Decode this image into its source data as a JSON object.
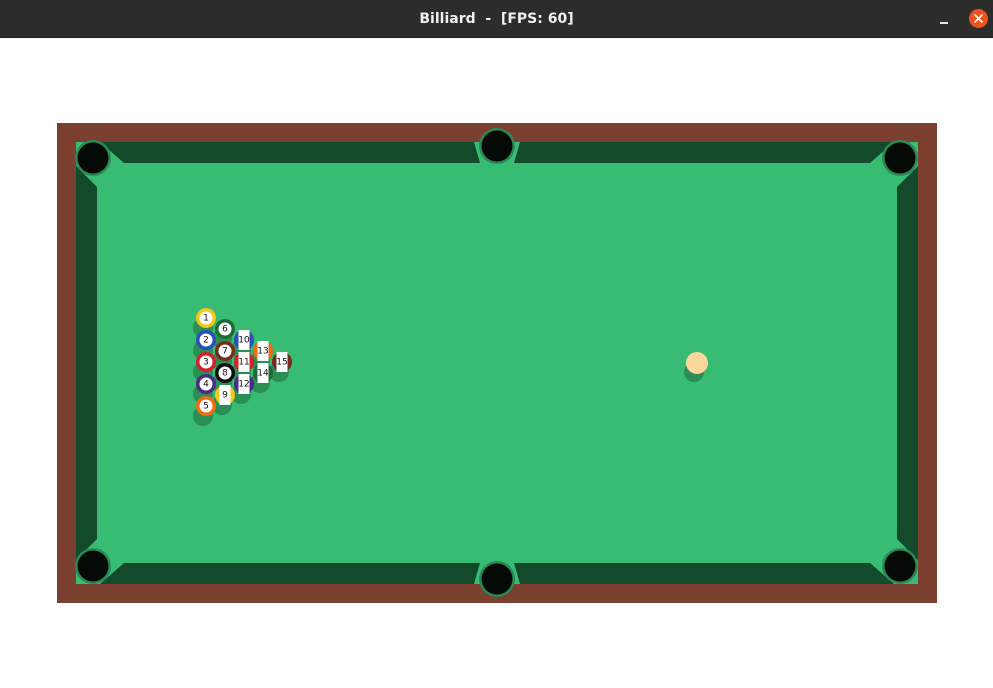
{
  "window": {
    "title": "Billiard  -  [FPS: 60]",
    "controls": [
      "minimize-icon",
      "close-icon"
    ]
  },
  "colors": {
    "background": "#ffffff",
    "wood_rail": "#7a3f2e",
    "cushion": "#134a2b",
    "felt": "#38bc73",
    "pocket": "#050a07",
    "pocket_rim": "#2a8a54",
    "ball_shadow": "#2a8e55",
    "cue_ball": "#fcd79e",
    "close_button": "#e95420"
  },
  "balls": [
    {
      "number": "1",
      "color": "#f5c518",
      "stripe": false
    },
    {
      "number": "2",
      "color": "#2a4fb8",
      "stripe": false
    },
    {
      "number": "3",
      "color": "#d81e2a",
      "stripe": false
    },
    {
      "number": "4",
      "color": "#4b2a8c",
      "stripe": false
    },
    {
      "number": "5",
      "color": "#f26b12",
      "stripe": false
    },
    {
      "number": "6",
      "color": "#1f6b35",
      "stripe": false
    },
    {
      "number": "7",
      "color": "#7a2a1d",
      "stripe": false
    },
    {
      "number": "8",
      "color": "#111111",
      "stripe": false
    },
    {
      "number": "9",
      "color": "#f5c518",
      "stripe": true
    },
    {
      "number": "10",
      "color": "#2a4fb8",
      "stripe": true
    },
    {
      "number": "11",
      "color": "#d81e2a",
      "stripe": true
    },
    {
      "number": "12",
      "color": "#4b2a8c",
      "stripe": true
    },
    {
      "number": "13",
      "color": "#f26b12",
      "stripe": true
    },
    {
      "number": "14",
      "color": "#1f6b35",
      "stripe": true
    },
    {
      "number": "15",
      "color": "#7a2a1d",
      "stripe": true
    }
  ],
  "cue_ball": {
    "number": "",
    "color": "#fcd79e"
  }
}
